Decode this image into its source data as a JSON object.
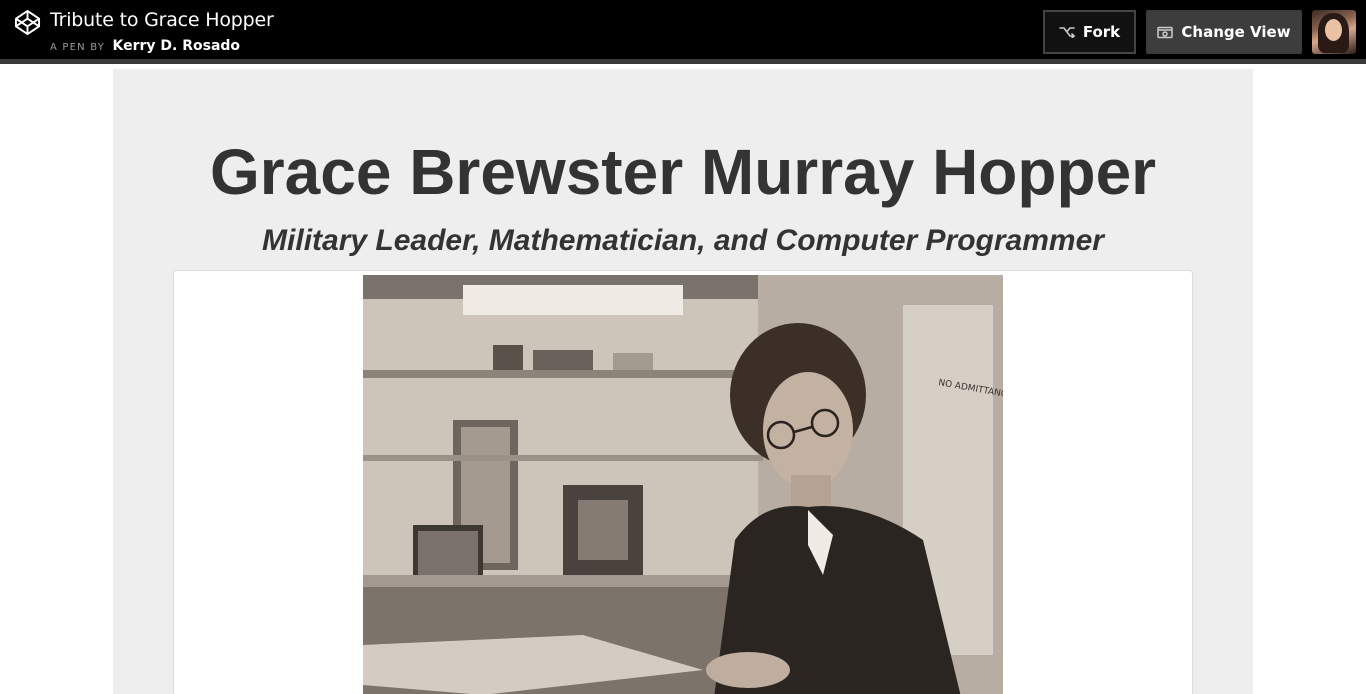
{
  "header": {
    "logo_icon": "codepen-logo-icon",
    "title": "Tribute to Grace Hopper",
    "by_prefix": "A PEN BY",
    "author": "Kerry D. Rosado",
    "fork_label": "Fork",
    "fork_icon": "fork-icon",
    "change_view_label": "Change View",
    "change_view_icon": "change-view-icon",
    "avatar": "user-avatar"
  },
  "main": {
    "title": "Grace Brewster Murray Hopper",
    "subtitle": "Military Leader, Mathematician, and Computer Programmer",
    "image_label": "NO ADMITTANCE"
  },
  "colors": {
    "topbar_bg": "#000000",
    "page_bg": "#eeeeee",
    "text": "#333333",
    "card_bg": "#ffffff"
  }
}
